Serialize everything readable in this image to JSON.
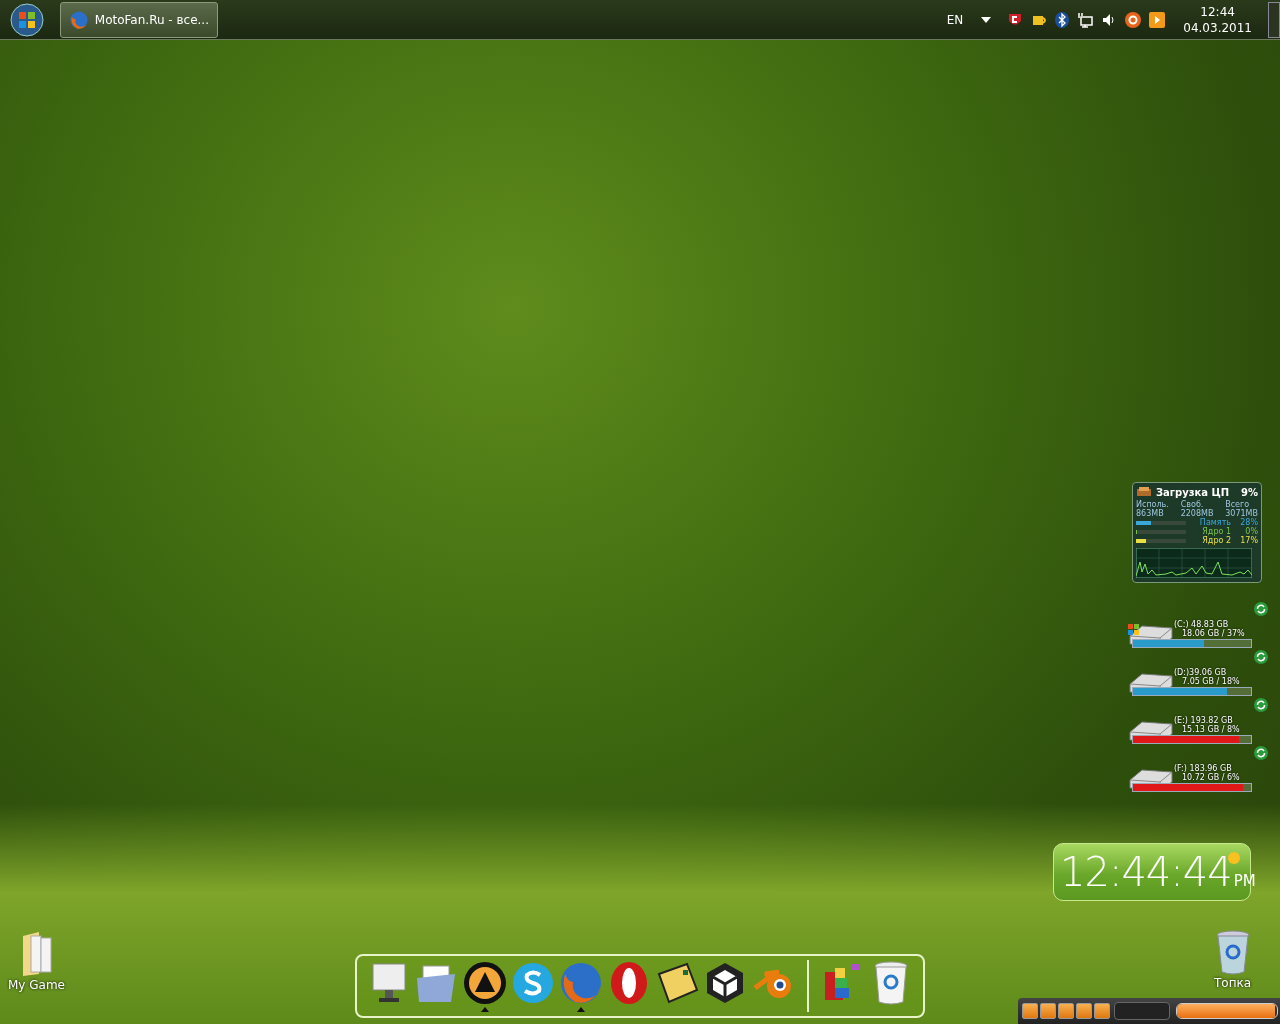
{
  "taskbar": {
    "window_buttons": [
      {
        "title": "MotoFan.Ru - все...",
        "selected": false
      }
    ],
    "language": "EN",
    "clock": {
      "time": "12:44",
      "date": "04.03.2011"
    }
  },
  "cpu_gadget": {
    "title": "Загрузка ЦП",
    "value": "9%",
    "headers": [
      "Исполь.",
      "Своб.",
      "Всего"
    ],
    "values": [
      "863MB",
      "2208MB",
      "3071MB"
    ],
    "meters": [
      {
        "label": "Память",
        "reading": "28%",
        "level": 0.28,
        "color": "#3aa8d8"
      },
      {
        "label": "Ядро 1",
        "reading": "0%",
        "level": 0,
        "color": "#7cc44a"
      },
      {
        "label": "Ядро 2",
        "reading": "17%",
        "level": 0.17,
        "color": "#e8e040"
      }
    ]
  },
  "drives": [
    {
      "title": "(C:) 48.83 GB",
      "detail": "18.06 GB / 37%",
      "level": 0.6,
      "color": "#2a9ccc",
      "kind": "system"
    },
    {
      "title": "(D:)39.06 GB",
      "detail": "7.05 GB / 18%",
      "level": 0.8,
      "color": "#2a9ccc",
      "kind": "plain"
    },
    {
      "title": "(E:) 193.82 GB",
      "detail": "15.13 GB / 8%",
      "level": 0.9,
      "color": "#e01818",
      "kind": "plain"
    },
    {
      "title": "(F:) 183.96 GB",
      "detail": "10.72 GB / 6%",
      "level": 0.93,
      "color": "#e01818",
      "kind": "plain"
    }
  ],
  "clock_gadget": {
    "time": "12:44:44",
    "period": "PM"
  },
  "desktop_icons": [
    {
      "label": "My Game",
      "kind": "folder"
    },
    {
      "label": "Топка",
      "kind": "bin"
    }
  ],
  "dock": [
    {
      "kind": "monitor",
      "running": false
    },
    {
      "kind": "folder",
      "running": false
    },
    {
      "kind": "aimp",
      "running": true
    },
    {
      "kind": "skype",
      "running": false
    },
    {
      "kind": "firefox",
      "running": true
    },
    {
      "kind": "opera",
      "running": false
    },
    {
      "kind": "mail",
      "running": false
    },
    {
      "kind": "unity",
      "running": false
    },
    {
      "kind": "blender",
      "running": false
    },
    {
      "kind": "separator"
    },
    {
      "kind": "blocks",
      "running": false
    },
    {
      "kind": "bin",
      "running": false
    }
  ],
  "player": {
    "level": 0.98
  }
}
